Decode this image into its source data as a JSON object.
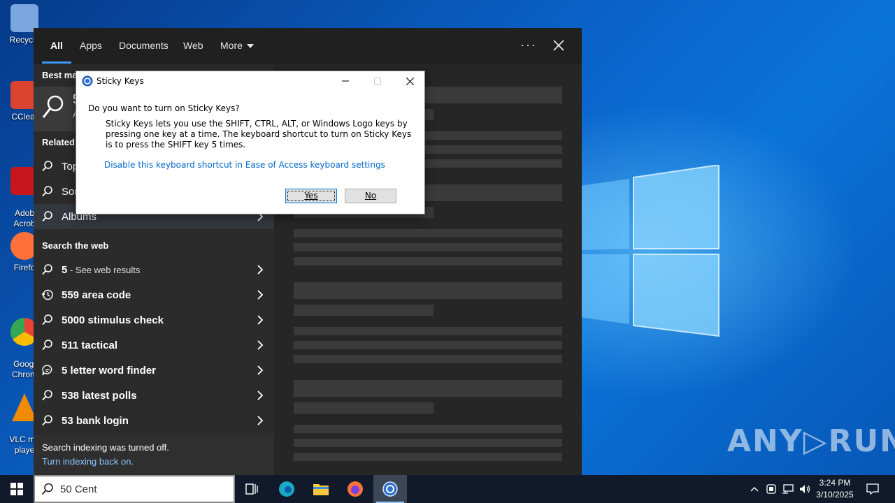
{
  "desktop": {
    "icons": [
      {
        "label": "Recycle",
        "color": "#5c8fd6"
      },
      {
        "label": "CClear",
        "color": "#d9432f"
      },
      {
        "label": "Adob\nAcrob",
        "color": "#c8161d"
      },
      {
        "label": "Firefo",
        "color": "#ff7139"
      },
      {
        "label": "Googl\nChrom",
        "color": "#34a853"
      },
      {
        "label": "VLC me\nplaye",
        "color": "#f08a00"
      }
    ],
    "watermark": "ANY▷RUN"
  },
  "search_panel": {
    "tabs": [
      "All",
      "Apps",
      "Documents",
      "Web",
      "More"
    ],
    "active_tab": "All",
    "more_dots": "···",
    "best_match_title": "Best ma",
    "best_match_letters": [
      "5",
      "A"
    ],
    "related_title": "Related",
    "related_items": [
      "Top",
      "Sor",
      "Albums"
    ],
    "web_title": "Search the web",
    "web_items": [
      {
        "bold": "5",
        "dim": " - See web results",
        "icon": "search-icon"
      },
      {
        "bold": "559 area code",
        "dim": "",
        "icon": "history-icon"
      },
      {
        "bold": "5000 stimulus check",
        "dim": "",
        "icon": "search-icon"
      },
      {
        "bold": "511 tactical",
        "dim": "",
        "icon": "search-icon"
      },
      {
        "bold": "5 letter word finder",
        "dim": "",
        "icon": "chat-icon"
      },
      {
        "bold": "538 latest polls",
        "dim": "",
        "icon": "search-icon"
      },
      {
        "bold": "53 bank login",
        "dim": "",
        "icon": "search-icon"
      }
    ],
    "footer_text": "Search indexing was turned off.",
    "footer_link": "Turn indexing back on."
  },
  "dialog": {
    "title": "Sticky Keys",
    "question": "Do you want to turn on Sticky Keys?",
    "body": "Sticky Keys lets you use the SHIFT, CTRL, ALT, or Windows Logo keys by pressing one key at a time. The keyboard shortcut to turn on Sticky Keys is to press the SHIFT key 5 times.",
    "link": "Disable this keyboard shortcut in Ease of Access keyboard settings",
    "yes_label": "Yes",
    "no_label": "No"
  },
  "taskbar": {
    "search_value": "50 Cent",
    "clock_time": "3:24 PM",
    "clock_date": "3/10/2025"
  },
  "colors": {
    "accent": "#3d9bff",
    "link": "#0066cc",
    "panel_bg": "#202020"
  }
}
